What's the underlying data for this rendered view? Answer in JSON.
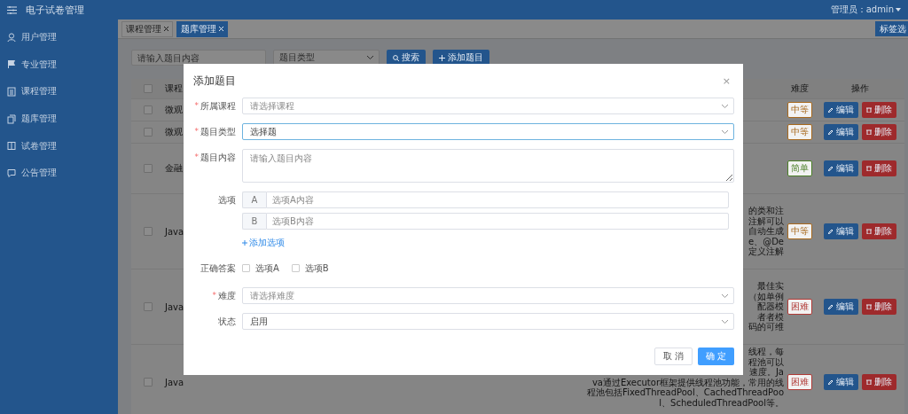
{
  "header": {
    "title": "电子试卷管理",
    "user": "管理员：admin"
  },
  "sidebar": {
    "items": [
      {
        "label": "用户管理"
      },
      {
        "label": "专业管理"
      },
      {
        "label": "课程管理"
      },
      {
        "label": "题库管理"
      },
      {
        "label": "试卷管理"
      },
      {
        "label": "公告管理"
      }
    ]
  },
  "tabs": [
    {
      "label": "课程管理",
      "selected": false
    },
    {
      "label": "题库管理",
      "selected": true
    }
  ],
  "tab_options": "标签选",
  "search": {
    "placeholder": "请输入题目内容",
    "type_placeholder": "题目类型",
    "search_button": "搜索",
    "add_button": "添加题目"
  },
  "table": {
    "select_all_checked": false,
    "columns": [
      "课程",
      "难度",
      "操作"
    ],
    "rows": [
      {
        "course": "微观",
        "content": [],
        "difficulty": "中等",
        "color": "#a8691d",
        "checked": false,
        "edit": "编辑",
        "delete": "删除"
      },
      {
        "course": "微观",
        "content": [],
        "difficulty": "中等",
        "color": "#a8691d",
        "checked": false,
        "edit": "编辑",
        "delete": "删除"
      },
      {
        "course": "金融",
        "content": [],
        "difficulty": "简单",
        "color": "#4a7f26",
        "checked": false,
        "edit": "编辑",
        "delete": "删除"
      },
      {
        "course": "Java",
        "content": [
          "的类和注",
          "注解可以",
          "自动生成",
          "e、@De",
          "定义注解"
        ],
        "difficulty": "中等",
        "color": "#a8691d",
        "checked": false,
        "edit": "编辑",
        "delete": "删除"
      },
      {
        "course": "Java",
        "content": [
          "最佳实",
          "（如单例",
          "配器模",
          "者者模",
          "码的可维"
        ],
        "difficulty": "困难",
        "color": "#b03a36",
        "checked": false,
        "edit": "编辑",
        "delete": "删除"
      },
      {
        "course": "Java",
        "content": [
          "线程，每",
          "程池可以",
          "速度。Ja",
          "va通过Executor框架提供线程池功能，常用的线",
          "程池包括FixedThreadPool、CachedThreadPoo",
          "l、ScheduledThreadPool等。"
        ],
        "difficulty": "困难",
        "color": "#b03a36",
        "checked": false,
        "edit": "编辑",
        "delete": "删除"
      }
    ]
  },
  "dialog": {
    "title": "添加题目",
    "close": "×",
    "fields": [
      {
        "kind": "select",
        "mark": "*",
        "label": "所属课程",
        "placeholder": "请选择课程",
        "focused": false
      },
      {
        "kind": "select",
        "mark": "*",
        "label": "题目类型",
        "value": "选择题",
        "focused": true
      },
      {
        "kind": "textarea",
        "mark": "*",
        "label": "题目内容",
        "placeholder": "请输入题目内容"
      },
      {
        "kind": "options",
        "label": "选项",
        "options": [
          {
            "key": "A",
            "placeholder": "选项A内容"
          },
          {
            "key": "B",
            "placeholder": "选项B内容"
          }
        ],
        "add_link": "添加选项"
      },
      {
        "kind": "checkboxes",
        "label": "正确答案",
        "options": [
          {
            "label": "选项A",
            "checked": false
          },
          {
            "label": "选项B",
            "checked": false
          }
        ]
      },
      {
        "kind": "select",
        "mark": "*",
        "label": "难度",
        "placeholder": "请选择难度",
        "focused": false
      },
      {
        "kind": "select",
        "label": "状态",
        "value": "启用",
        "focused": false
      }
    ],
    "cancel": "取 消",
    "confirm": "确 定"
  }
}
